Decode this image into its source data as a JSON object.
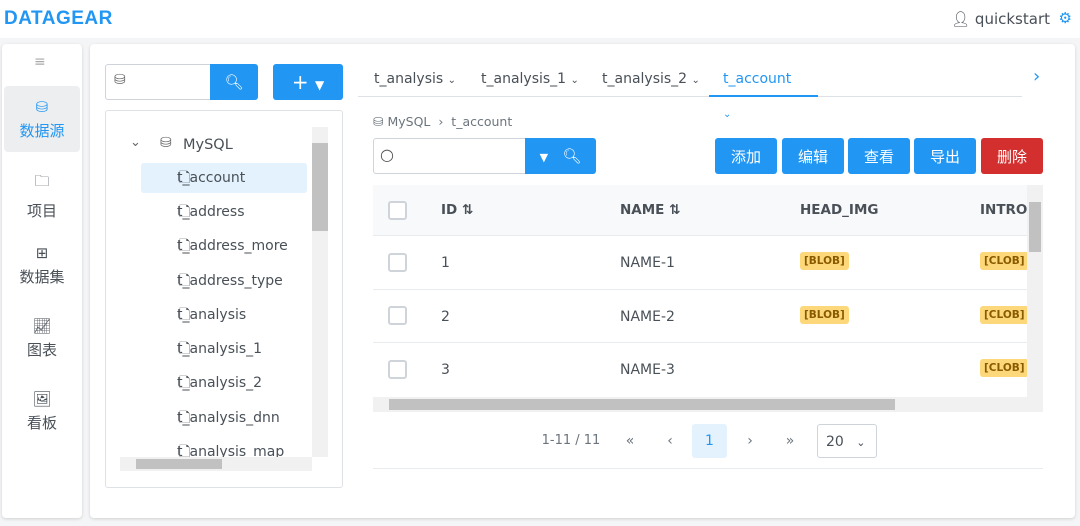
{
  "header": {
    "logo": "DATAGEAR",
    "user": "quickstart",
    "accent": "#2196f3"
  },
  "sidebar": {
    "items": [
      {
        "label": "数据源",
        "icon": "database-icon",
        "active": true
      },
      {
        "label": "项目",
        "icon": "folder-icon"
      },
      {
        "label": "数据集",
        "icon": "table-icon"
      },
      {
        "label": "图表",
        "icon": "chart-icon"
      },
      {
        "label": "看板",
        "icon": "dashboard-icon"
      }
    ]
  },
  "tree": {
    "root": "MySQL",
    "items": [
      "t_account",
      "t_address",
      "t_address_more",
      "t_address_type",
      "t_analysis",
      "t_analysis_1",
      "t_analysis_2",
      "t_analysis_dnn",
      "t_analysis_map"
    ],
    "selected": "t_account"
  },
  "tabs": [
    "t_analysis",
    "t_analysis_1",
    "t_analysis_2",
    "t_account"
  ],
  "active_tab": "t_account",
  "breadcrumb": {
    "db": "MySQL",
    "table": "t_account"
  },
  "actions": {
    "add": "添加",
    "edit": "编辑",
    "view": "查看",
    "export": "导出",
    "delete": "删除",
    "delete_color": "#d32f2f"
  },
  "table": {
    "columns": [
      "ID",
      "NAME",
      "HEAD_IMG",
      "INTRO"
    ],
    "rows": [
      {
        "id": "1",
        "name": "NAME-1",
        "head_img": "[BLOB]",
        "intro": "[CLOB]"
      },
      {
        "id": "2",
        "name": "NAME-2",
        "head_img": "[BLOB]",
        "intro": "[CLOB]"
      },
      {
        "id": "3",
        "name": "NAME-3",
        "head_img": "",
        "intro": "[CLOB]"
      }
    ]
  },
  "pagination": {
    "summary": "1-11 / 11",
    "current": "1",
    "page_size": "20"
  }
}
